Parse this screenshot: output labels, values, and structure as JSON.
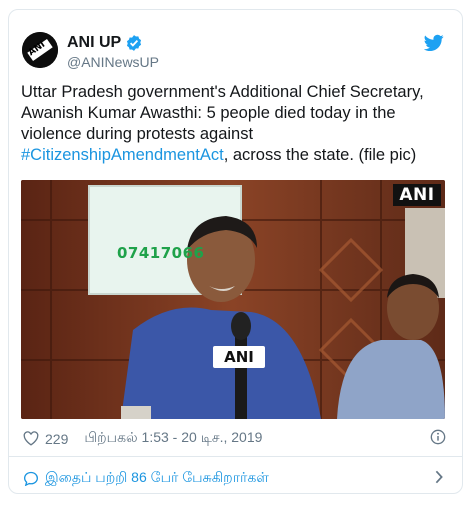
{
  "tweet": {
    "display_name": "ANI UP",
    "handle": "@ANINewsUP",
    "avatar_text": "ANI",
    "text_before": "Uttar Pradesh government's Additional Chief Secretary, Awanish Kumar Awasthi: 5 people died today in the violence during protests against ",
    "hashtag": "#CitizenshipAmendmentAct",
    "text_after": ", across the state. (file pic)",
    "media": {
      "badge": "ANI",
      "screen_number": "07417066",
      "mic_label": "ANI"
    },
    "likes": "229",
    "timestamp": "பிற்பகல் 1:53 - 20 டிச., 2019",
    "reply_prompt": "இதைப் பற்றி 86 பேர் பேசுகிறார்கள்"
  },
  "colors": {
    "link": "#1b95e0",
    "verified": "#1da1f2",
    "muted": "#657786"
  },
  "icons": [
    "verified-icon",
    "twitter-bird-icon",
    "heart-icon",
    "info-icon",
    "reply-bubble-icon",
    "chevron-right-icon"
  ]
}
